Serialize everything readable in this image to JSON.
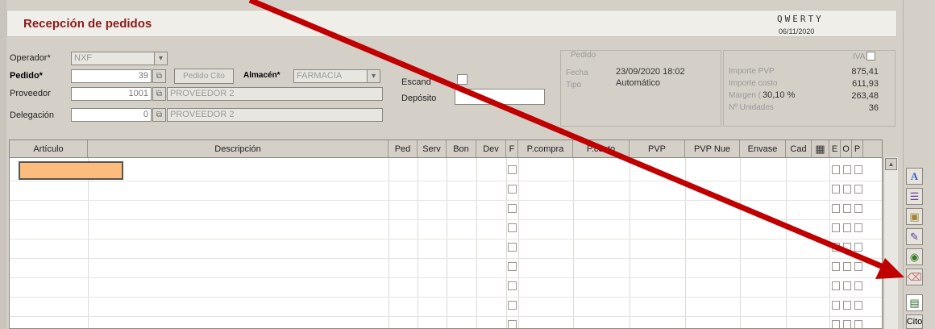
{
  "header": {
    "title": "Recepción de pedidos",
    "brand": "QWERTY",
    "date": "06/11/2020"
  },
  "form": {
    "operador_label": "Operador*",
    "operador_value": "NXF",
    "pedido_label": "Pedido*",
    "pedido_value": "39",
    "pedido_cito_label": "Pedido Cito",
    "almacen_label": "Almacén*",
    "almacen_value": "FARMACIA",
    "proveedor_label": "Proveedor",
    "proveedor_code": "1001",
    "proveedor_name": "PROVEEDOR 2",
    "delegacion_label": "Delegación",
    "delegacion_code": "0",
    "delegacion_name": "PROVEEDOR 2",
    "escandallo_label": "Escand",
    "deposito_label": "Depósito",
    "deposito_value": ""
  },
  "pedido_panel": {
    "title": "Pedido",
    "fecha_label": "Fecha",
    "fecha_value": "23/09/2020 18:02",
    "tipo_label": "Tipo",
    "tipo_value": "Automático"
  },
  "totals_panel": {
    "iva_label": "IVA",
    "importe_pvp_label": "Importe PVP",
    "importe_pvp_value": "875,41",
    "importe_costo_label": "Importe costo",
    "importe_costo_value": "611,93",
    "margen_label": "Margen (",
    "margen_pct": "30,10 %",
    "margen_value": "263,48",
    "unidades_label": "Nº Unidades",
    "unidades_value": "36"
  },
  "grid": {
    "columns": [
      "Artículo",
      "Descripción",
      "Ped",
      "Serv",
      "Bon",
      "Dev",
      "F",
      "P.compra",
      "P.costo",
      "PVP",
      "PVP Nue",
      "Envase",
      "Cad",
      "E",
      "O",
      "P"
    ]
  },
  "toolbar": {
    "cito_label": "Cito"
  }
}
